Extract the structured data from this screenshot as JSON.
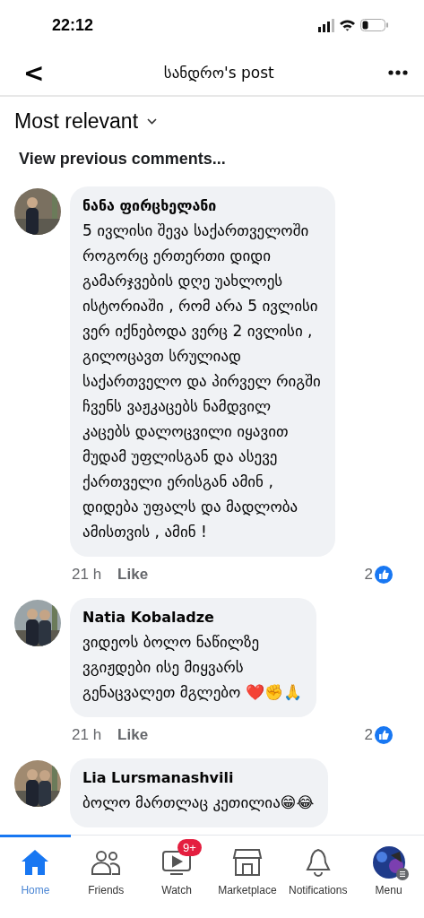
{
  "status_bar": {
    "time": "22:12"
  },
  "header": {
    "back": "<",
    "title": "სანდრო's post"
  },
  "sort": {
    "label": "Most relevant"
  },
  "view_previous": "View previous comments...",
  "comments": [
    {
      "author": "ნანა ფირცხელანი",
      "lines": [
        "5 ივლისი შევა საქართველოში",
        "როგორც ერთერთი დიდი",
        "გამარჯვების დღე უახლოეს",
        "ისტორიაში , რომ არა 5 ივლისი",
        "ვერ იქნებოდა ვერც 2 ივლისი ,",
        "გილოცავთ სრულიად",
        "საქართველო და პირველ რიგში",
        "ჩვენს ვაჟკაცებს ნამდვილ",
        "კაცებს დალოცვილი იყავით",
        "მუდამ უფლისგან და ასევე",
        "ქართველი ერისგან ამინ ,",
        "დიდება უფალს და მადლობა",
        "ამისთვის , ამინ !"
      ],
      "time": "21 h",
      "like": "Like",
      "reactions": "2"
    },
    {
      "author": "Natia  Kobaladze",
      "lines": [
        "ვიდეოს ბოლო ნაწილზე",
        "ვგიჟდები ისე მიყვარს",
        "გენაცვალეთ მგლებო ❤️✊🙏"
      ],
      "time": "21 h",
      "like": "Like",
      "reactions": "2"
    },
    {
      "author": "Lia Lursmanashvili",
      "lines": [
        "ბოლო მართლაც კეთილია😁😂"
      ]
    }
  ],
  "tab_bar": [
    {
      "kind": "home",
      "label": "Home",
      "selected": true
    },
    {
      "kind": "friends",
      "label": "Friends",
      "selected": false
    },
    {
      "kind": "watch",
      "label": "Watch",
      "selected": false,
      "badge": "9+"
    },
    {
      "kind": "marketplace",
      "label": "Marketplace",
      "selected": false
    },
    {
      "kind": "notifications",
      "label": "Notifications",
      "selected": false
    },
    {
      "kind": "menu",
      "label": "Menu",
      "selected": false
    }
  ]
}
